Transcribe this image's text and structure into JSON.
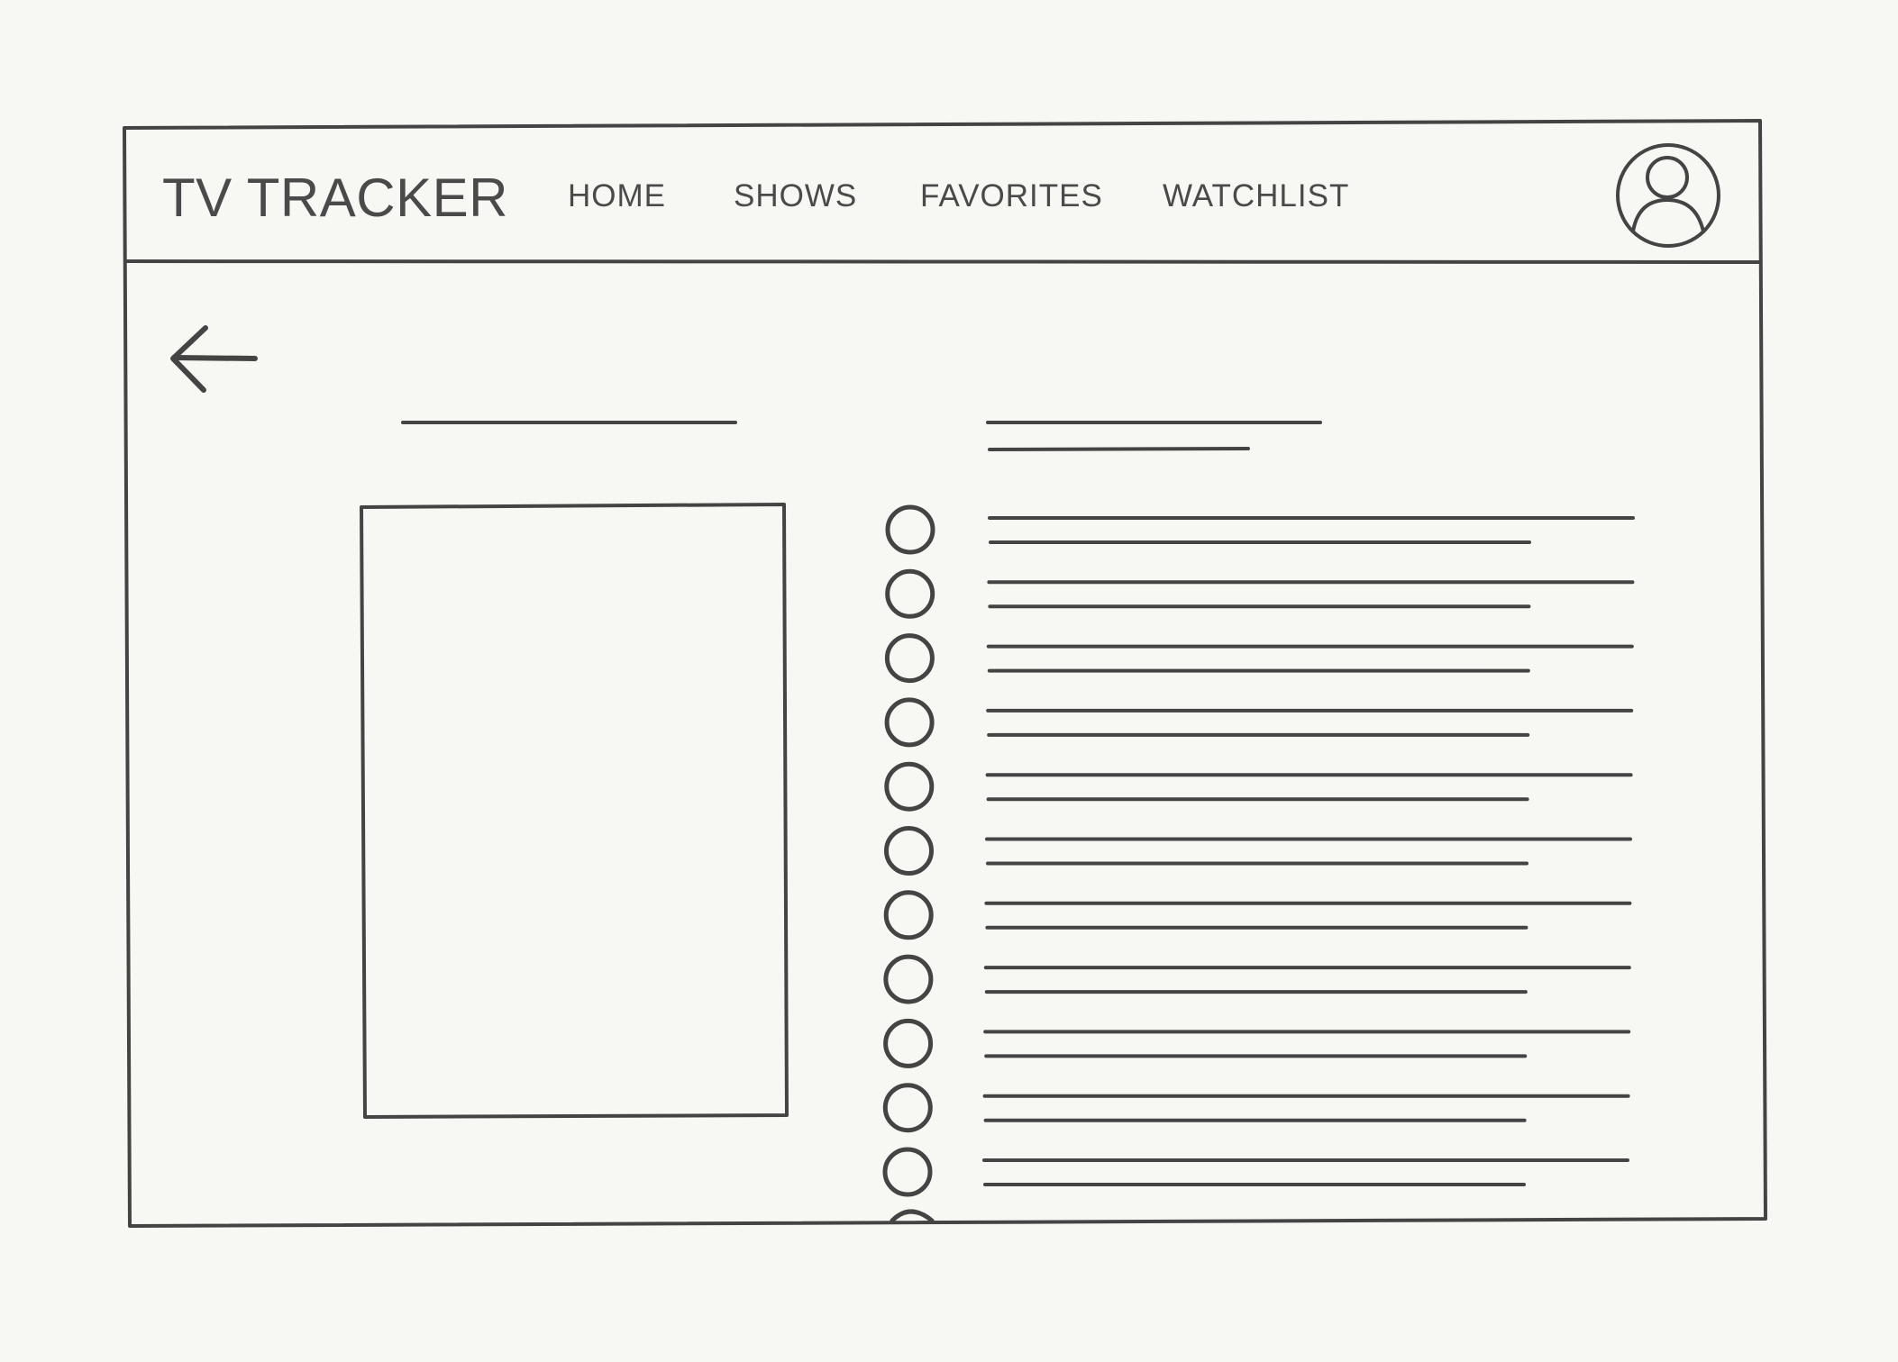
{
  "app": {
    "title": "TV TRACKER"
  },
  "nav": {
    "items": [
      {
        "id": "home",
        "label": "HOME"
      },
      {
        "id": "shows",
        "label": "SHOWS"
      },
      {
        "id": "favorites",
        "label": "FAVORITES"
      },
      {
        "id": "watchlist",
        "label": "WATCHLIST"
      }
    ]
  },
  "icons": {
    "back": "arrow-left-icon",
    "profile": "user-avatar-icon",
    "episode_toggle": "circle-checkbox-icon"
  },
  "episodes": {
    "visible_rows": 11,
    "partially_visible_rows": 1
  },
  "colors": {
    "background": "#f7f7f3",
    "stroke": "#444444",
    "text": "#4a4a4a"
  }
}
